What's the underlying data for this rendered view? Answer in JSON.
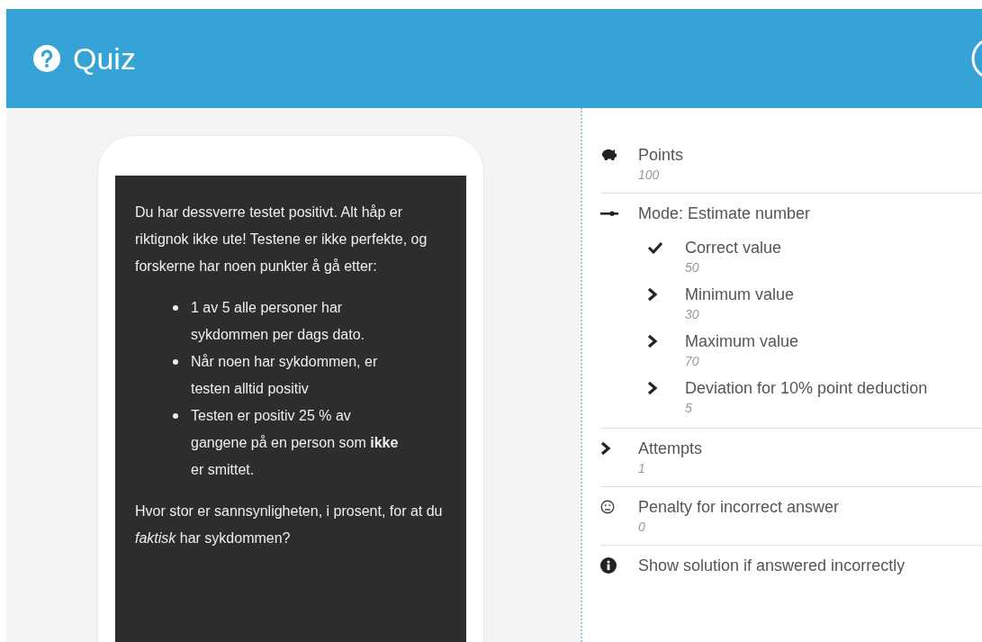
{
  "header": {
    "title": "Quiz"
  },
  "question": {
    "intro": "Du har dessverre testet positivt. Alt håp er riktignok ikke ute! Testene er ikke perfekte, og forskerne har noen punkter å gå etter:",
    "bullets": [
      "1 av 5 alle personer har sykdommen per dags dato.",
      "Når noen har sykdommen, er testen alltid positiv",
      "Testen er positiv 25 % av gangene på en person som **ikke** er smittet."
    ],
    "prompt": "Hvor stor er sannsynligheten, i prosent, for at du *faktisk* har sykdommen?"
  },
  "settings": [
    {
      "kind": "points",
      "label": "Points",
      "value": "100"
    },
    {
      "kind": "mode",
      "label": "Mode: Estimate number",
      "children": [
        {
          "kind": "check",
          "label": "Correct value",
          "value": "50"
        },
        {
          "kind": "chevron",
          "label": "Minimum value",
          "value": "30"
        },
        {
          "kind": "chevron",
          "label": "Maximum value",
          "value": "70"
        },
        {
          "kind": "chevron",
          "label": "Deviation for 10% point deduction",
          "value": "5"
        }
      ]
    },
    {
      "kind": "chevron",
      "label": "Attempts",
      "value": "1"
    },
    {
      "kind": "penalty",
      "label": "Penalty for incorrect answer",
      "value": "0"
    },
    {
      "kind": "info",
      "label": "Show solution if answered incorrectly"
    }
  ]
}
